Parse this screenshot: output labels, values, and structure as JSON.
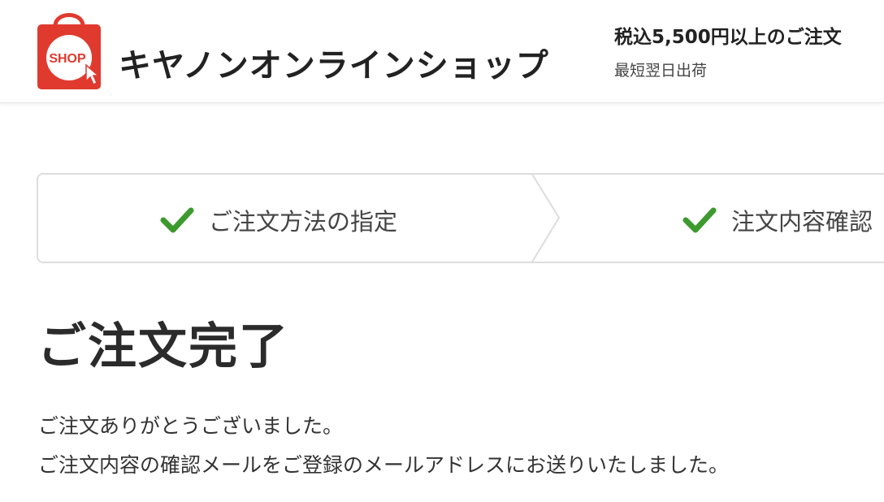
{
  "header": {
    "logo_badge": "SHOP",
    "shop_name": "キヤノンオンラインショップ",
    "promo_main": "税込5,500円以上のご注文",
    "promo_sub": "最短翌日出荷",
    "brand_color": "#e03a2f"
  },
  "progress": {
    "steps": [
      {
        "label": "ご注文方法の指定",
        "status": "completed"
      },
      {
        "label": "注文内容確認",
        "status": "completed"
      }
    ],
    "check_color": "#3c9a2e"
  },
  "main": {
    "title": "ご注文完了",
    "messages": [
      "ご注文ありがとうございました。",
      "ご注文内容の確認メールをご登録のメールアドレスにお送りいたしました。"
    ]
  }
}
